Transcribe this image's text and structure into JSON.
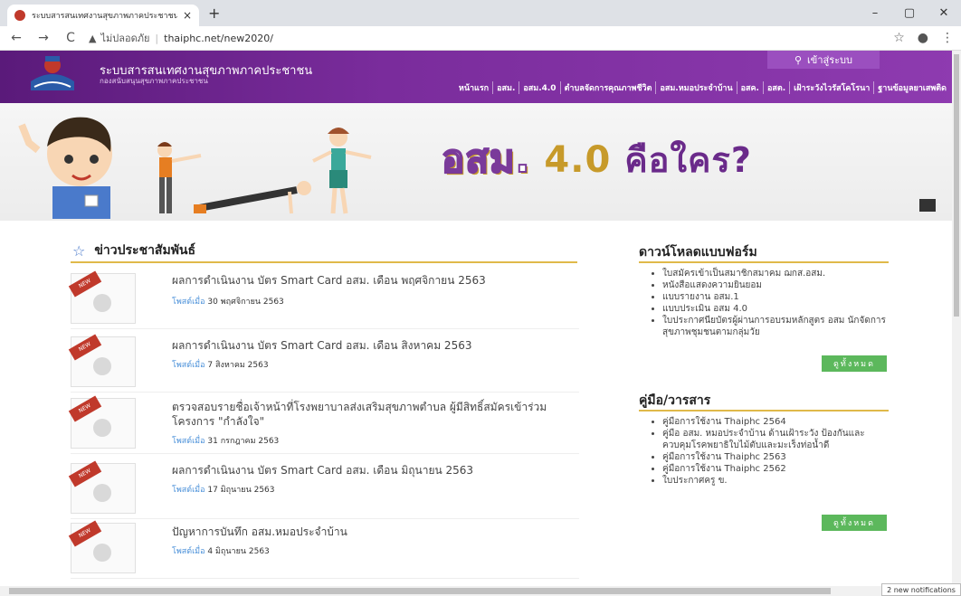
{
  "browser": {
    "tab_title": "ระบบสารสนเทศงานสุขภาพภาคประชาชน",
    "tab_close": "×",
    "new_tab": "+",
    "win_min": "–",
    "win_max": "▢",
    "win_close": "✕",
    "insecure_label": "ไม่ปลอดภัย",
    "url": "thaiphc.net/new2020/"
  },
  "site": {
    "title": "ระบบสารสนเทศงานสุขภาพภาคประชาชน",
    "subtitle": "กองสนับสนุนสุขภาพภาคประชาชน",
    "login_label": "เข้าสู่ระบบ",
    "menu": [
      "หน้าแรก",
      "อสม.",
      "อสม.4.0",
      "ตำบลจัดการคุณภาพชีวิต",
      "อสม.หมอประจำบ้าน",
      "อสค.",
      "อสต.",
      "เฝ้าระวังไวรัสโคโรนา",
      "ฐานข้อมูลยาเสพติด"
    ]
  },
  "banner": {
    "part1": "อสม.",
    "part2": " 4.0 ",
    "part3": "คือใคร?"
  },
  "news": {
    "heading": "ข่าวประชาสัมพันธ์",
    "posted_label": "โพสต์เมื่อ",
    "new_badge": "NEW",
    "items": [
      {
        "title": "ผลการดำเนินงาน บัตร Smart Card อสม. เดือน พฤศจิกายน 2563",
        "date": "30 พฤศจิกายน 2563"
      },
      {
        "title": "ผลการดำเนินงาน บัตร Smart Card อสม. เดือน สิงหาคม 2563",
        "date": "7 สิงหาคม 2563"
      },
      {
        "title": "ตรวจสอบรายชื่อเจ้าหน้าที่โรงพยาบาลส่งเสริมสุขภาพตำบล ผู้มีสิทธิ์สมัครเข้าร่วมโครงการ \"กำลังใจ\"",
        "date": "31 กรกฎาคม 2563"
      },
      {
        "title": "ผลการดำเนินงาน บัตร Smart Card อสม. เดือน มิถุนายน 2563",
        "date": "17 มิถุนายน 2563"
      },
      {
        "title": "ปัญหาการบันทึก อสม.หมอประจำบ้าน",
        "date": "4 มิถุนายน 2563"
      }
    ]
  },
  "downloads": {
    "heading": "ดาวน์โหลดแบบฟอร์ม",
    "items": [
      "ใบสมัครเข้าเป็นสมาชิกสมาคม ฌกส.อสม.",
      "หนังสือแสดงความยินยอม",
      "แบบรายงาน อสม.1",
      "แบบประเมิน อสม 4.0",
      "ใบประกาศนียบัตรผู้ผ่านการอบรมหลักสูตร อสม นักจัดการสุขภาพชุมชนตามกลุ่มวัย"
    ],
    "see_all": "ดูทั้งหมด"
  },
  "manuals": {
    "heading": "คู่มือ/วารสาร",
    "items": [
      "คู่มือการใช้งาน Thaiphc 2564",
      "คู่มือ อสม. หมอประจำบ้าน ด้านเฝ้าระวัง ป้องกันและควบคุมโรคพยาธิใบไม้ตับและมะเร็งท่อน้ำดี",
      "คู่มือการใช้งาน Thaiphc 2563",
      "คู่มือการใช้งาน Thaiphc 2562",
      "ใบประกาศครู ข."
    ],
    "see_all": "ดูทั้งหมด"
  },
  "notification": "2 new notifications"
}
